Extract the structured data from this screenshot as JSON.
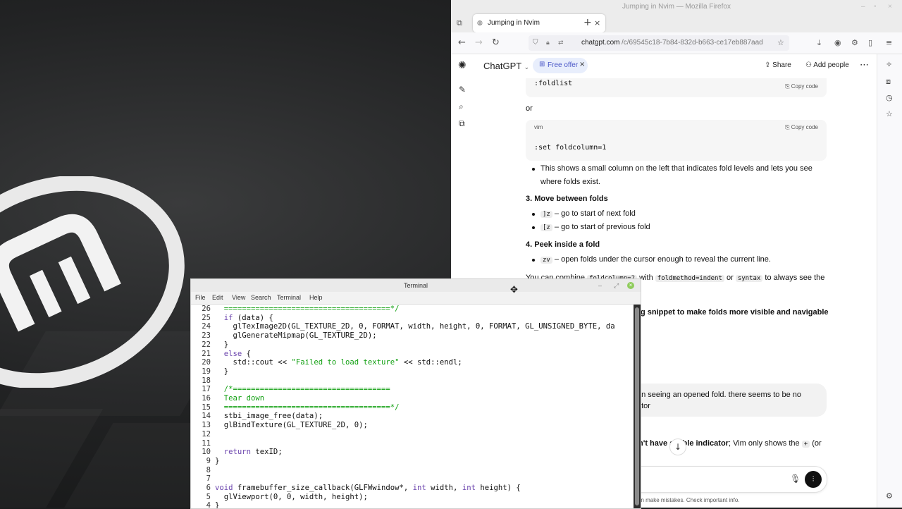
{
  "firefox": {
    "window_title": "Jumping in Nvim — Mozilla Firefox",
    "tab_title": "Jumping in Nvim",
    "url_host": "chatgpt.com",
    "url_path": "/c/69545c18-7b84-832d-b663-ce17eb887aad"
  },
  "chat": {
    "brand": "ChatGPT",
    "offer_label": "Free offer",
    "share_label": "Share",
    "add_people_label": "Add people",
    "code1": ":foldlist",
    "copy_label": "Copy code",
    "or_text": "or",
    "code2_lang": "vim",
    "code2": ":set foldcolumn=1",
    "bullet1_line1": "This shows a small column on the left that indicates fold levels and lets you see",
    "bullet1_line2": "where folds exist.",
    "h3": "3. Move between folds",
    "b2_code": "]z",
    "b2_text": "– go to start of next fold",
    "b3_code": "[z",
    "b3_text": "– go to start of previous fold",
    "h4": "4. Peek inside a fold",
    "b4_code": "zv",
    "b4_text": "– open folds under the cursor enough to reveal the current line.",
    "combine_a": "You can combine",
    "combine_code1": "foldcolumn=2",
    "combine_b": "with",
    "combine_code2": "foldmethod=indent",
    "combine_c": "or",
    "combine_code3": "syntax",
    "combine_d": "to always see the",
    "snippet_tail": "g snippet to make folds more visible and navigable",
    "user_line1": "an seeing an opened fold. there seems to be no",
    "user_line2": "ator",
    "reply_bold": "n't have a",
    "reply_bold2": "ible indicator",
    "reply_rest": "; Vim only shows the",
    "reply_code": "+",
    "reply_tail": "(or",
    "disclaimer": "an make mistakes. Check important info."
  },
  "terminal": {
    "title": "Terminal",
    "menu": [
      "File",
      "Edit",
      "View",
      "Search",
      "Terminal",
      "Help"
    ],
    "lines": [
      {
        "n": "26",
        "t": "  =====================================*/",
        "c": "cm"
      },
      {
        "n": "25",
        "t": "  if (data) {",
        "c": ""
      },
      {
        "n": "24",
        "t": "    glTexImage2D(GL_TEXTURE_2D, 0, FORMAT, width, height, 0, FORMAT, GL_UNSIGNED_BYTE, da",
        "c": ""
      },
      {
        "n": "23",
        "t": "    glGenerateMipmap(GL_TEXTURE_2D);",
        "c": ""
      },
      {
        "n": "22",
        "t": "  }",
        "c": ""
      },
      {
        "n": "21",
        "t": "  else {",
        "c": ""
      },
      {
        "n": "20",
        "t": "    std::cout << \"Failed to load texture\" << std::endl;",
        "c": ""
      },
      {
        "n": "19",
        "t": "  }",
        "c": ""
      },
      {
        "n": "18",
        "t": "",
        "c": ""
      },
      {
        "n": "17",
        "t": "  /*===================================",
        "c": "cm"
      },
      {
        "n": "16",
        "t": "  Tear down",
        "c": "cm"
      },
      {
        "n": "15",
        "t": "  =====================================*/",
        "c": "cm"
      },
      {
        "n": "14",
        "t": "  stbi_image_free(data);",
        "c": ""
      },
      {
        "n": "13",
        "t": "  glBindTexture(GL_TEXTURE_2D, 0);",
        "c": ""
      },
      {
        "n": "12",
        "t": "",
        "c": ""
      },
      {
        "n": "11",
        "t": "",
        "c": ""
      },
      {
        "n": "10",
        "t": "  return texID;",
        "c": ""
      },
      {
        "n": "9",
        "t": "}",
        "c": ""
      },
      {
        "n": "8",
        "t": "",
        "c": ""
      },
      {
        "n": "7",
        "t": "",
        "c": ""
      },
      {
        "n": "6",
        "t": "void framebuffer_size_callback(GLFWwindow*, int width, int height) {",
        "c": ""
      },
      {
        "n": "5",
        "t": "  glViewport(0, 0, width, height);",
        "c": ""
      },
      {
        "n": "4",
        "t": "}",
        "c": ""
      }
    ]
  }
}
